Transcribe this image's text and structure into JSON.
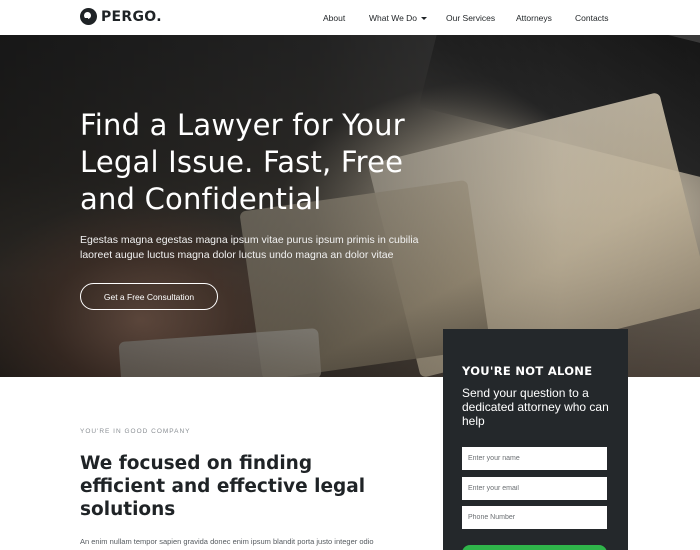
{
  "brand": {
    "name": "PERGO."
  },
  "nav": {
    "items": [
      {
        "label": "About"
      },
      {
        "label": "What We Do",
        "has_dropdown": true
      },
      {
        "label": "Our Services"
      },
      {
        "label": "Attorneys"
      },
      {
        "label": "Contacts"
      }
    ]
  },
  "hero": {
    "title": "Find a Lawyer for Your Legal Issue. Fast, Free and Confidential",
    "subtitle": "Egestas magna egestas magna ipsum vitae purus ipsum primis in cubilia laoreet augue luctus magna dolor luctus undo magna an dolor vitae",
    "cta_label": "Get a Free Consultation"
  },
  "intro": {
    "eyebrow": "YOU'RE IN GOOD COMPANY",
    "title": "We focused on finding efficient and effective legal solutions",
    "text": "An enim nullam tempor sapien gravida donec enim ipsum blandit porta justo integer odio"
  },
  "contact_panel": {
    "title": "YOU'RE NOT ALONE",
    "subtitle": "Send your question to a dedicated attorney who can help",
    "fields": {
      "name_placeholder": "Enter your name",
      "email_placeholder": "Enter your email",
      "phone_placeholder": "Phone Number"
    }
  },
  "colors": {
    "panel_bg": "#24282b",
    "accent_green": "#2fb54a",
    "text_dark": "#1f2326"
  }
}
